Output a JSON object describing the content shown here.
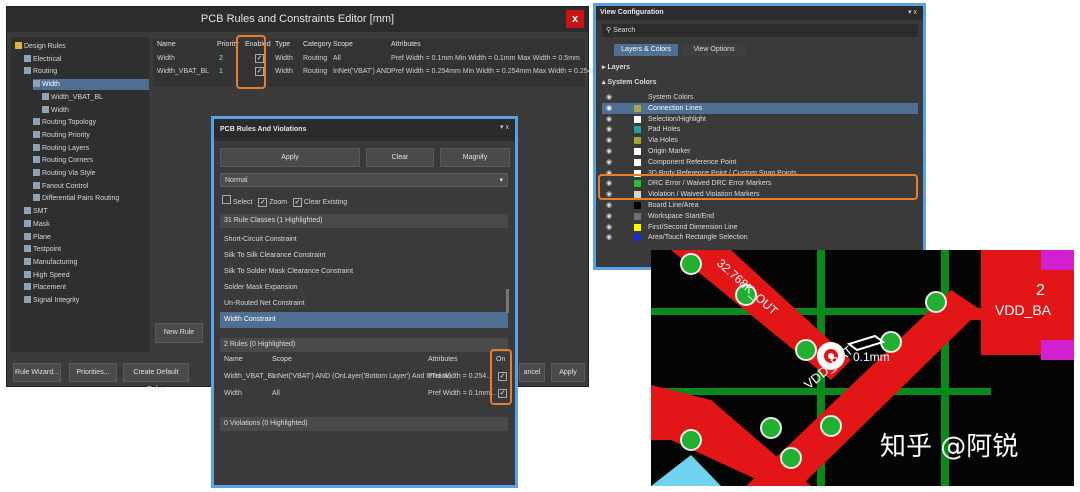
{
  "rules_editor": {
    "title": "PCB Rules and Constraints Editor [mm]",
    "close_label": "x",
    "tree": [
      {
        "label": "Design Rules",
        "indent": 0,
        "icon": "folder-icon"
      },
      {
        "label": "Electrical",
        "indent": 1,
        "icon": "rule-icon"
      },
      {
        "label": "Routing",
        "indent": 1,
        "icon": "rule-icon"
      },
      {
        "label": "Width",
        "indent": 2,
        "icon": "rule-icon",
        "selected": true
      },
      {
        "label": "Width_VBAT_BL",
        "indent": 3,
        "icon": "rule-icon"
      },
      {
        "label": "Width",
        "indent": 3,
        "icon": "rule-icon"
      },
      {
        "label": "Routing Topology",
        "indent": 2,
        "icon": "rule-icon"
      },
      {
        "label": "Routing Priority",
        "indent": 2,
        "icon": "rule-icon"
      },
      {
        "label": "Routing Layers",
        "indent": 2,
        "icon": "rule-icon"
      },
      {
        "label": "Routing Corners",
        "indent": 2,
        "icon": "rule-icon"
      },
      {
        "label": "Routing Via Style",
        "indent": 2,
        "icon": "rule-icon"
      },
      {
        "label": "Fanout Control",
        "indent": 2,
        "icon": "rule-icon"
      },
      {
        "label": "Differential Pairs Routing",
        "indent": 2,
        "icon": "rule-icon"
      },
      {
        "label": "SMT",
        "indent": 1,
        "icon": "rule-icon"
      },
      {
        "label": "Mask",
        "indent": 1,
        "icon": "rule-icon"
      },
      {
        "label": "Plane",
        "indent": 1,
        "icon": "rule-icon"
      },
      {
        "label": "Testpoint",
        "indent": 1,
        "icon": "rule-icon"
      },
      {
        "label": "Manufacturing",
        "indent": 1,
        "icon": "rule-icon"
      },
      {
        "label": "High Speed",
        "indent": 1,
        "icon": "rule-icon"
      },
      {
        "label": "Placement",
        "indent": 1,
        "icon": "rule-icon"
      },
      {
        "label": "Signal Integrity",
        "indent": 1,
        "icon": "rule-icon"
      }
    ],
    "columns": [
      "Name",
      "Priority",
      "Enabled",
      "Type",
      "Category",
      "Scope",
      "Attributes"
    ],
    "rows": [
      {
        "name": "Width",
        "priority": "2",
        "enabled": "✓",
        "type": "Width",
        "category": "Routing",
        "scope": "All",
        "attributes": "Pref Width = 0.1mm   Min Width = 0.1mm   Max Width = 0.5mm"
      },
      {
        "name": "Width_VBAT_BL",
        "priority": "1",
        "enabled": "✓",
        "type": "Width",
        "category": "Routing",
        "scope": "InNet('VBAT') AND",
        "attributes": "Pref Width = 0.254mm   Min Width = 0.254mm   Max Width = 0.254mm"
      }
    ],
    "buttons": {
      "new_rule": "New Rule",
      "rule_wizard": "Rule Wizard...",
      "priorities": "Priorities...",
      "create_default": "Create Default Rules",
      "cancel": "ancel",
      "apply": "Apply"
    }
  },
  "violations_panel": {
    "title": "PCB Rules And Violations",
    "title_controls": "▾ x",
    "buttons": {
      "apply": "Apply",
      "clear": "Clear",
      "magnify": "Magnify"
    },
    "mode": "Normal",
    "options": {
      "select": "Select",
      "zoom": "Zoom",
      "clear_existing": "Clear Existing"
    },
    "classes_header": "31 Rule Classes (1 Highlighted)",
    "classes": [
      "Short-Circuit Constraint",
      "Silk To Silk Clearance Constraint",
      "Silk To Solder Mask Clearance Constraint",
      "Solder Mask Expansion",
      "Un-Routed Net Constraint",
      "Width Constraint"
    ],
    "rules_header": "2 Rules (0 Highlighted)",
    "rule_columns": [
      "Name",
      "Scope",
      "Attributes",
      "On"
    ],
    "rules": [
      {
        "name": "Width_VBAT_BL",
        "scope": "InNet('VBAT') AND (OnLayer('Bottom Layer') And IsTrack)",
        "attributes": "Pref Width = 0.254...",
        "on": "✓"
      },
      {
        "name": "Width",
        "scope": "All",
        "attributes": "Pref Width = 0.1mm...",
        "on": "✓"
      }
    ],
    "violations_header": "0 Violations (0 Highlighted)"
  },
  "view_config": {
    "title": "View Configuration",
    "title_controls": "▾ x",
    "search_placeholder": "Search",
    "tabs": [
      "Layers & Colors",
      "View Options"
    ],
    "sections": [
      "Layers",
      "System Colors"
    ],
    "items": [
      {
        "label": "System Colors",
        "color": "#3a3a3a"
      },
      {
        "label": "Connection Lines",
        "color": "#a8a44a"
      },
      {
        "label": "Selection/Highlight",
        "color": "#ffffff"
      },
      {
        "label": "Pad Holes",
        "color": "#1aa6a0"
      },
      {
        "label": "Via Holes",
        "color": "#a3a33c"
      },
      {
        "label": "Origin Marker",
        "color": "#ffffff"
      },
      {
        "label": "Component Reference Point",
        "color": "#ffffff"
      },
      {
        "label": "3D Body Reference Point / Custom Snap Points",
        "color": "#ffffff"
      },
      {
        "label": "DRC Error / Waived DRC Error Markers",
        "color": "#22c02a"
      },
      {
        "label": "Violation / Waived Violation Markers",
        "color": "#d6d6c6"
      },
      {
        "label": "Board Line/Area",
        "color": "#000000"
      },
      {
        "label": "Workspace Start/End",
        "color": "#707070"
      },
      {
        "label": "First/Second Dimension Line",
        "color": "#ffff00"
      },
      {
        "label": "Area/Touch Rectangle Selection",
        "color": "#1a2ad6"
      }
    ]
  },
  "pcb_view": {
    "net_label_1": "32.768K_OUT",
    "net_label_2": "VDD_BAT",
    "width_label": "0.1mm",
    "pad_label": "2",
    "pad_net": "VDD_BA"
  },
  "watermark": "知乎 @阿锐"
}
